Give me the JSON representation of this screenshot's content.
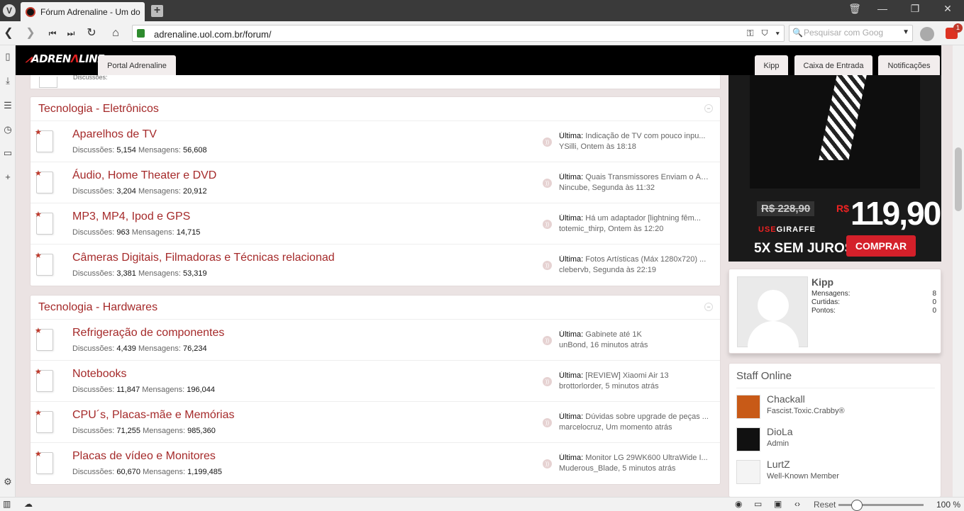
{
  "browser": {
    "tab_title": "Fórum Adrenaline - Um do",
    "url": "adrenaline.uol.com.br/forum/",
    "search_placeholder": "Pesquisar com Goog",
    "notification_count": "1",
    "zoom_reset_label": "Reset",
    "zoom_level": "100 %"
  },
  "site": {
    "logo_left": "ADREN",
    "logo_right": "LINE",
    "portal_tab": "Portal Adrenaline",
    "user_nav": [
      "Kipp",
      "Caixa de Entrada",
      "Notificações"
    ]
  },
  "stat_labels": {
    "discussions": "Discussões:",
    "messages": "Mensagens:",
    "last": "Última:"
  },
  "categories": [
    {
      "title": "Tecnologia - Eletrônicos",
      "forums": [
        {
          "title": "Aparelhos de TV",
          "discussions": "5,154",
          "messages": "56,608",
          "last_title": "Indicação de TV com pouco inpu...",
          "last_meta": "YSilli, Ontem às 18:18"
        },
        {
          "title": "Áudio, Home Theater e DVD",
          "discussions": "3,204",
          "messages": "20,912",
          "last_title": "Quais Transmissores Enviam o Áu...",
          "last_meta": "Nincube, Segunda às 11:32"
        },
        {
          "title": "MP3, MP4, Ipod e GPS",
          "discussions": "963",
          "messages": "14,715",
          "last_title": "Há um adaptador [lightning fêm...",
          "last_meta": "totemic_thirp, Ontem às 12:20"
        },
        {
          "title": "Câmeras Digitais, Filmadoras e Técnicas relacionad",
          "discussions": "3,381",
          "messages": "53,319",
          "last_title": "Fotos Artísticas (Máx 1280x720) ...",
          "last_meta": "clebervb, Segunda às 22:19"
        }
      ]
    },
    {
      "title": "Tecnologia - Hardwares",
      "forums": [
        {
          "title": "Refrigeração de componentes",
          "discussions": "4,439",
          "messages": "76,234",
          "last_title": "Gabinete até 1K",
          "last_meta": "unBond, 16 minutos atrás"
        },
        {
          "title": "Notebooks",
          "discussions": "11,847",
          "messages": "196,044",
          "last_title": "[REVIEW] Xiaomi Air 13",
          "last_meta": "brottorlorder, 5 minutos atrás"
        },
        {
          "title": "CPU´s, Placas-mãe e Memórias",
          "discussions": "71,255",
          "messages": "985,360",
          "last_title": "Dúvidas sobre upgrade de peças ...",
          "last_meta": "marcelocruz, Um momento atrás"
        },
        {
          "title": "Placas de vídeo e Monitores",
          "discussions": "60,670",
          "messages": "1,199,485",
          "last_title": "Monitor LG 29WK600 UltraWide I...",
          "last_meta": "Muderous_Blade, 5 minutos atrás"
        }
      ]
    }
  ],
  "ad": {
    "old_price": "R$ 228,90",
    "currency": "R$",
    "new_price": "119,90",
    "brand_prefix": "USE",
    "brand_name": "GIRAFFE",
    "terms": "5X SEM JUROS",
    "cta": "COMPRAR"
  },
  "profile": {
    "name": "Kipp",
    "stats": [
      {
        "label": "Mensagens:",
        "value": "8"
      },
      {
        "label": "Curtidas:",
        "value": "0"
      },
      {
        "label": "Pontos:",
        "value": "0"
      }
    ]
  },
  "staff": {
    "title": "Staff Online",
    "members": [
      {
        "name": "Chackall",
        "role": "Fascist.Toxic.Crabby®"
      },
      {
        "name": "DioLa",
        "role": "Admin"
      },
      {
        "name": "LurtZ",
        "role": "Well-Known Member"
      }
    ]
  },
  "colors": {
    "link": "#a52a2a",
    "brand_red": "#d22",
    "page_bg": "#ebe3e3"
  }
}
